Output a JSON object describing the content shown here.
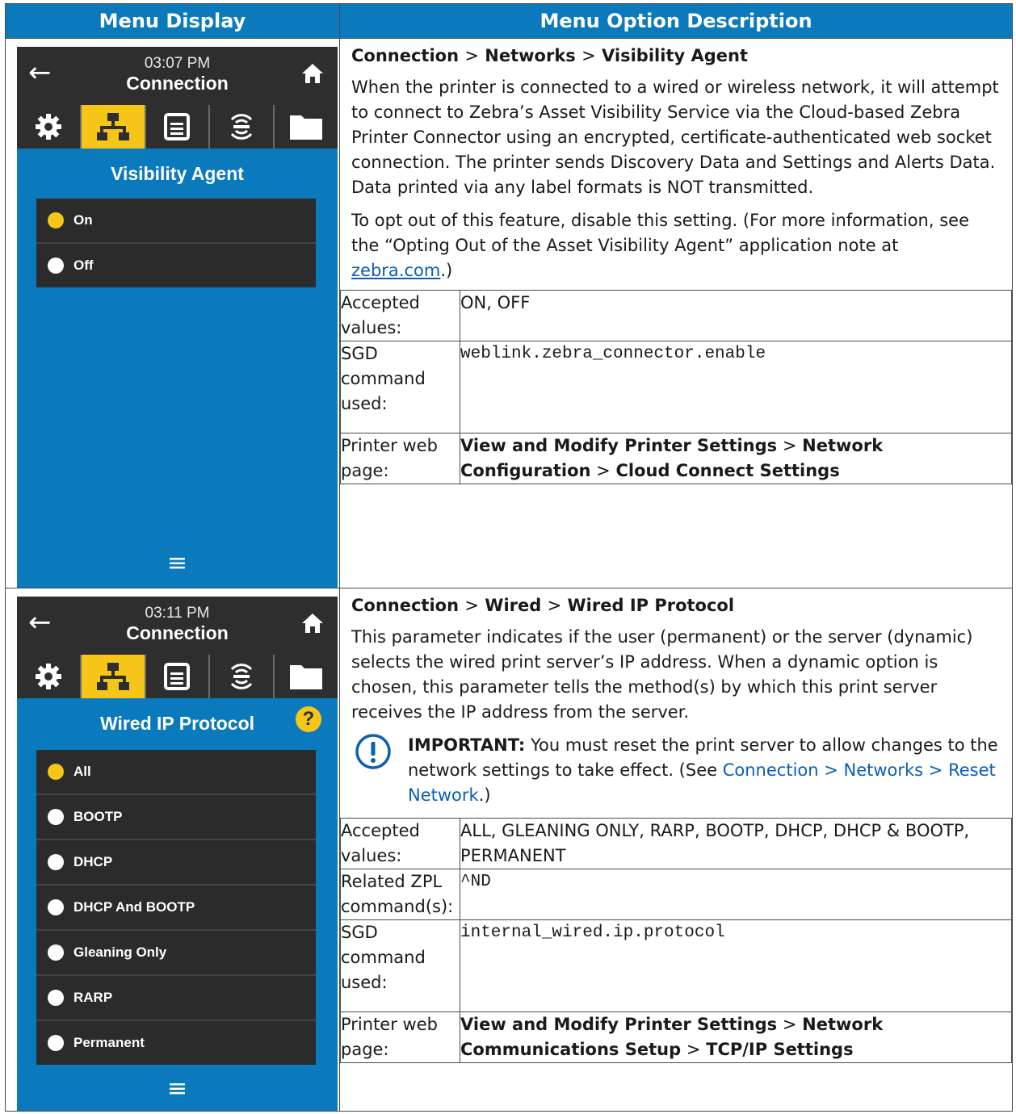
{
  "headers": {
    "col1": "Menu Display",
    "col2": "Menu Option Description"
  },
  "rows": [
    {
      "screen": {
        "time": "03:07 PM",
        "title": "Connection",
        "heading": "Visibility Agent",
        "options": [
          "On",
          "Off"
        ]
      },
      "crumb": {
        "a": "Connection",
        "b": "Networks",
        "c": "Visibility Agent",
        "sep": ">"
      },
      "para1": "When the printer is connected to a wired or wireless network, it will attempt to connect to Zebra’s Asset Visibility Service via the Cloud-based Zebra Printer Connector using an encrypted, certificate-authenticated web socket connection. The printer sends Discovery Data and Settings and Alerts Data. Data printed via any label formats is NOT transmitted.",
      "para2_pre": "To opt out of this feature, disable this setting. (For more information, see the “Opting Out of the Asset Visibility Agent” application note at ",
      "para2_link": "zebra.com",
      "para2_post": ".)",
      "accepted_label": "Accepted values:",
      "accepted_value": "ON, OFF",
      "sgd_label": "SGD command used:",
      "sgd_value": "weblink.zebra_connector.enable",
      "web_label": "Printer web page:",
      "web_a": "View and Modify Printer Settings",
      "web_b": "Network Configuration",
      "web_c": "Cloud Connect Settings"
    },
    {
      "screen": {
        "time": "03:11 PM",
        "title": "Connection",
        "heading": "Wired IP Protocol",
        "help": "?",
        "options": [
          "All",
          "BOOTP",
          "DHCP",
          "DHCP And BOOTP",
          "Gleaning Only",
          "RARP",
          "Permanent"
        ]
      },
      "crumb": {
        "a": "Connection",
        "b": "Wired",
        "c": "Wired IP Protocol",
        "sep": ">"
      },
      "para1": "This parameter indicates if the user (permanent) or the server (dynamic) selects the wired print server’s IP address. When a dynamic option is chosen, this parameter tells the method(s) by which this print server receives the IP address from the server.",
      "important_label": "IMPORTANT:",
      "important_text": " You must reset the print server to allow changes to the network settings to take effect. (See ",
      "important_link": "Connection > Networks > Reset Network",
      "important_post": ".)",
      "accepted_label": "Accepted values:",
      "accepted_value": "ALL, GLEANING ONLY, RARP, BOOTP, DHCP, DHCP & BOOTP, PERMANENT",
      "zpl_label": "Related ZPL command(s):",
      "zpl_value": "^ND",
      "sgd_label": "SGD command used:",
      "sgd_value": "internal_wired.ip.protocol",
      "web_label": "Printer web page:",
      "web_a": "View and Modify Printer Settings",
      "web_b": "Network Communications Setup",
      "web_c": "TCP/IP Settings"
    }
  ],
  "colors": {
    "header_blue": "#0a7abd",
    "screen_blue": "#0a7abd",
    "accent_yellow": "#f5c518",
    "dark_bar": "#2e2e2e",
    "link_blue": "#0a5fb4"
  },
  "icons": [
    "back-arrow-icon",
    "home-icon",
    "settings-gear-icon",
    "network-icon",
    "printer-icon",
    "rfid-icon",
    "folder-icon",
    "menu-icon",
    "help-icon",
    "important-exclamation-icon"
  ]
}
